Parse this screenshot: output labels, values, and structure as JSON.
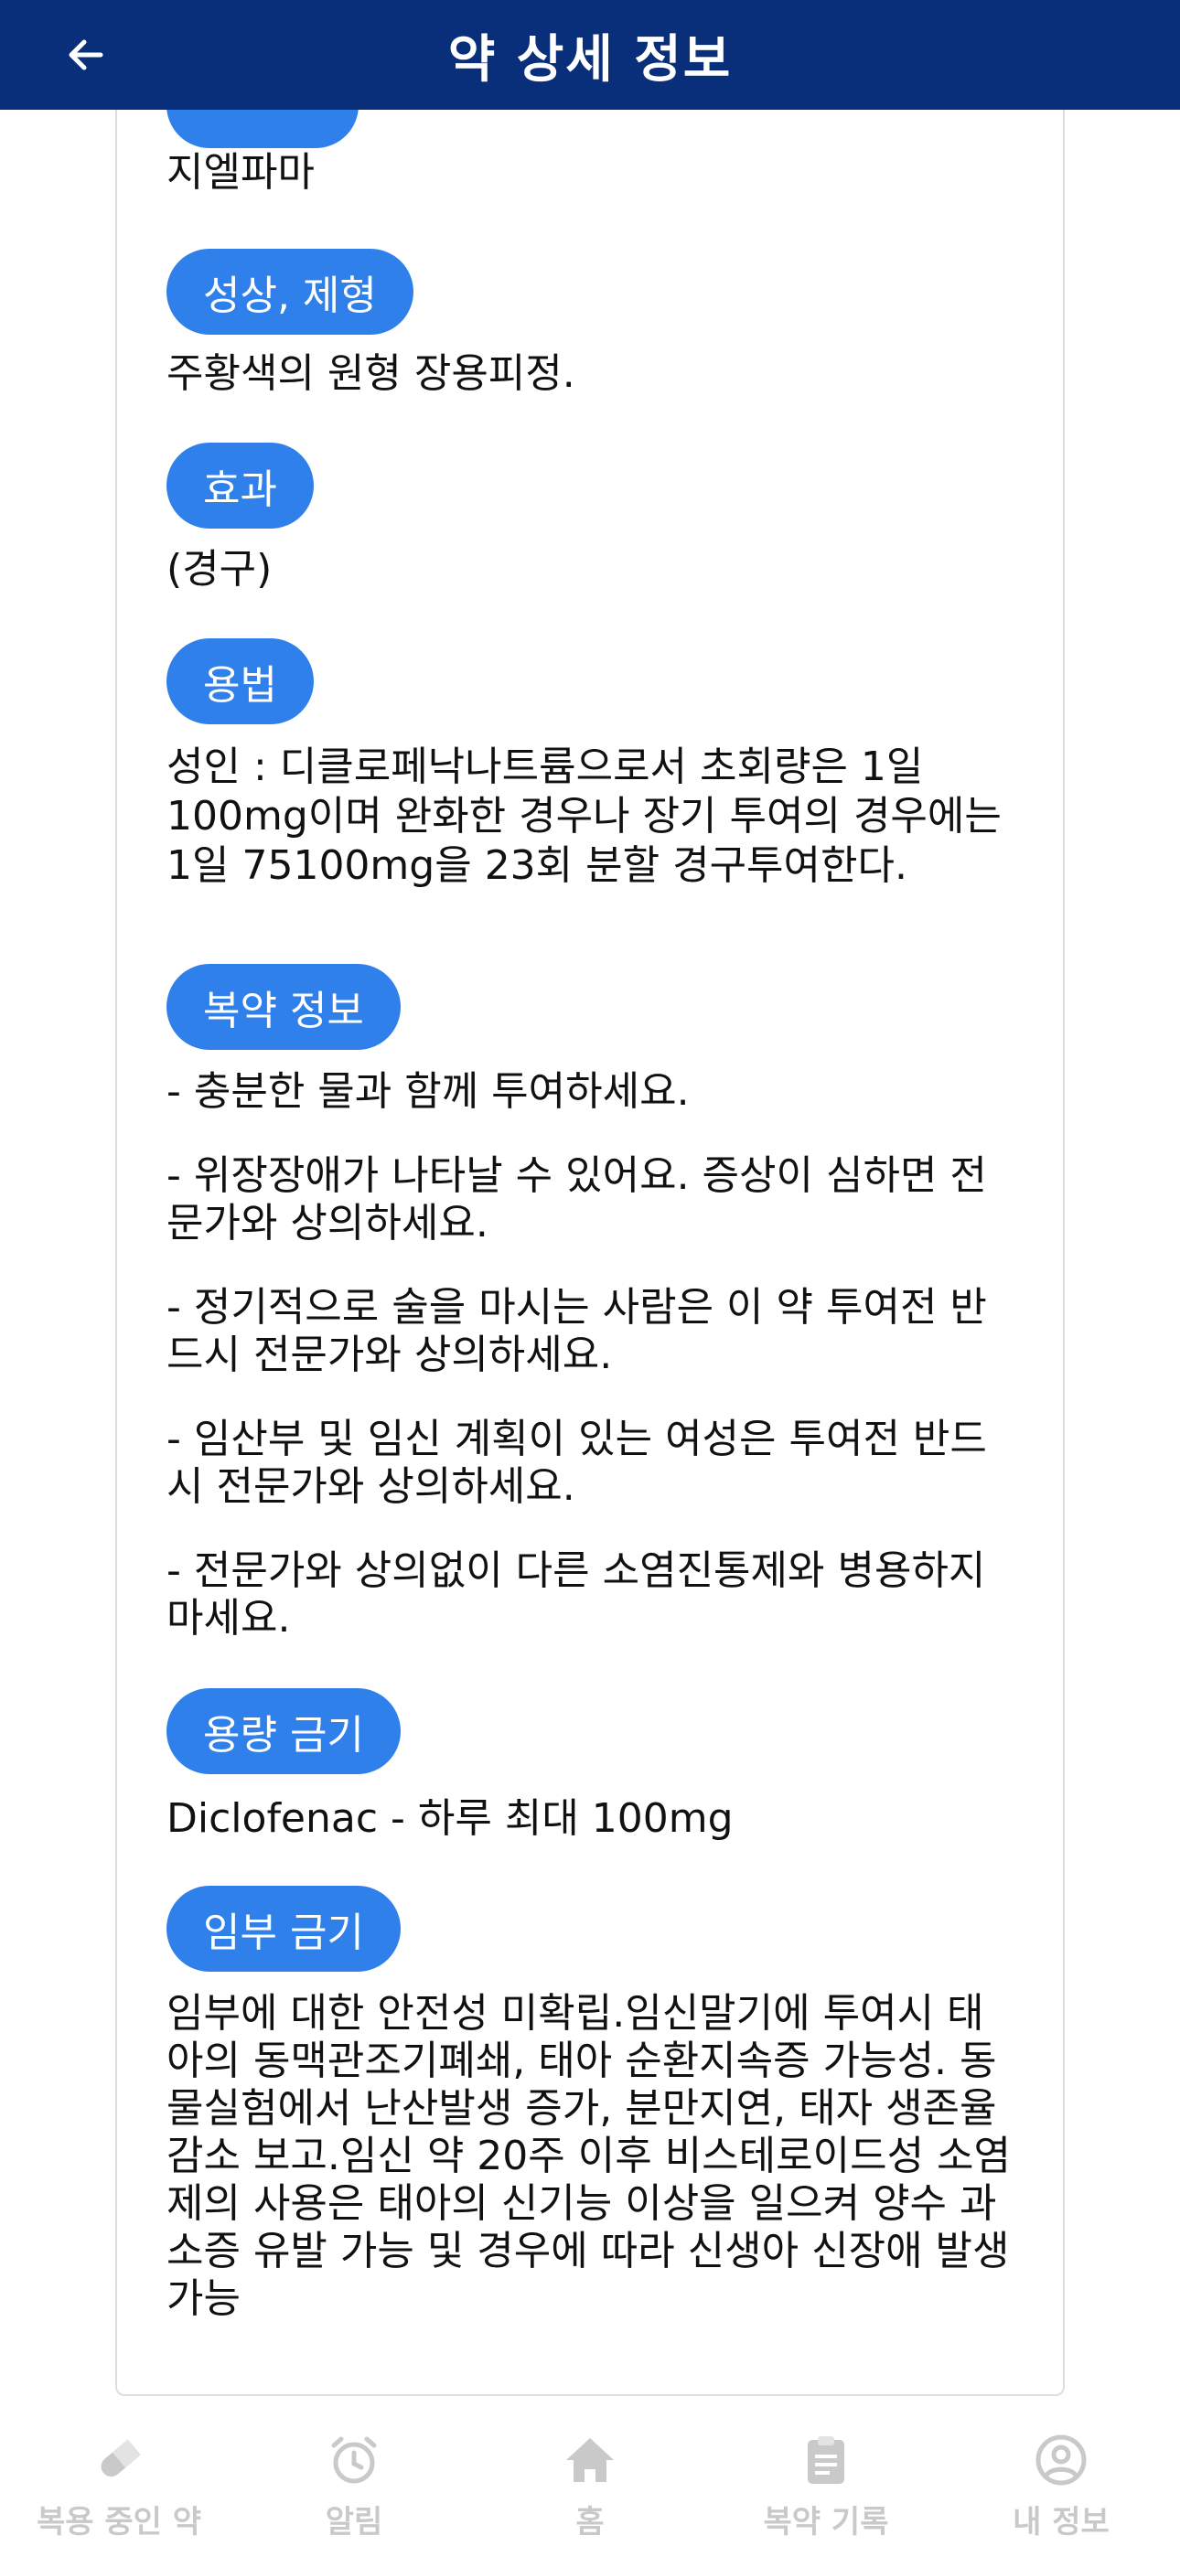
{
  "header": {
    "title": "약 상세 정보",
    "back_icon": "arrow-left-icon"
  },
  "colors": {
    "header_bg": "#0a2f7a",
    "pill_bg": "#2f80ea",
    "tab_inactive": "#c9c9c9"
  },
  "detail": {
    "manufacturer": "지엘파마",
    "appearance_label": "성상, 제형",
    "appearance": "주황색의 원형 장용피정.",
    "effect_label": "효과",
    "effect": "(경구)",
    "dosage_label": "용법",
    "dosage": "성인 : 디클로페낙나트륨으로서 초회량은 1일 100mg이며 완화한 경우나 장기 투여의 경우에는 1일 75100mg을 23회 분할 경구투여한다.",
    "medication_info_label": "복약 정보",
    "medication_info": [
      "- 충분한 물과 함께 투여하세요.",
      "- 위장장애가 나타날 수 있어요. 증상이 심하면 전문가와 상의하세요.",
      "- 정기적으로 술을 마시는 사람은 이 약 투여전 반드시 전문가와 상의하세요.",
      "- 임산부 및 임신 계획이 있는 여성은 투여전 반드시 전문가와 상의하세요.",
      "- 전문가와 상의없이 다른 소염진통제와 병용하지 마세요."
    ],
    "dose_limit_label": "용량 금기",
    "dose_limit": "Diclofenac - 하루 최대 100mg",
    "pregnancy_label": "임부 금기",
    "pregnancy": "임부에 대한 안전성 미확립.임신말기에 투여시 태아의 동맥관조기폐쇄, 태아 순환지속증 가능성. 동물실험에서 난산발생 증가, 분만지연, 태자 생존율 감소 보고.임신 약 20주 이후 비스테로이드성 소염제의 사용은 태아의 신기능 이상을 일으켜 양수 과소증 유발 가능 및 경우에 따라 신생아 신장애 발생 가능"
  },
  "tabs": [
    {
      "label": "복용 중인 약",
      "icon": "pill-icon"
    },
    {
      "label": "알림",
      "icon": "alarm-clock-icon"
    },
    {
      "label": "홈",
      "icon": "home-icon"
    },
    {
      "label": "복약 기록",
      "icon": "clipboard-icon"
    },
    {
      "label": "내 정보",
      "icon": "user-circle-icon"
    }
  ]
}
